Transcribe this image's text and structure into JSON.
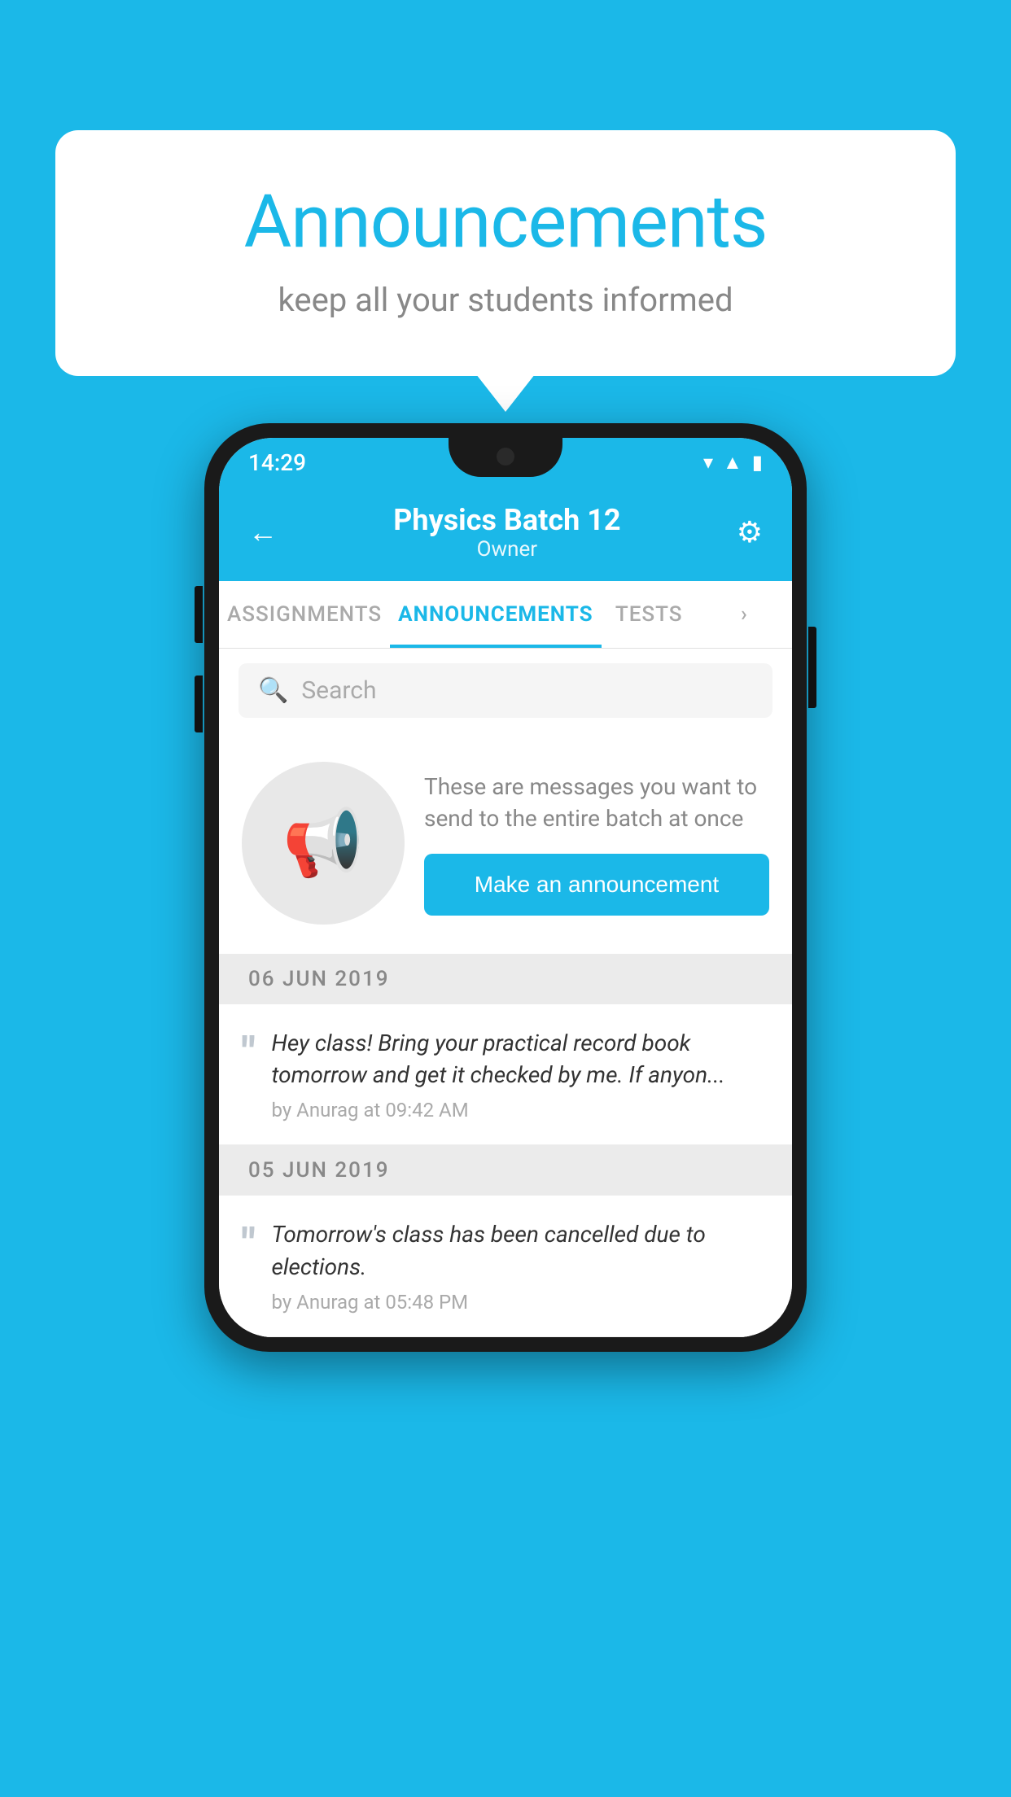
{
  "page": {
    "background_color": "#1BB8E8"
  },
  "speech_bubble": {
    "title": "Announcements",
    "subtitle": "keep all your students informed"
  },
  "phone": {
    "status_bar": {
      "time": "14:29",
      "icons": [
        "wifi",
        "signal",
        "battery"
      ]
    },
    "header": {
      "title": "Physics Batch 12",
      "subtitle": "Owner",
      "back_label": "←",
      "settings_label": "⚙"
    },
    "tabs": [
      {
        "label": "ASSIGNMENTS",
        "active": false
      },
      {
        "label": "ANNOUNCEMENTS",
        "active": true
      },
      {
        "label": "TESTS",
        "active": false
      },
      {
        "label": "›",
        "active": false
      }
    ],
    "search": {
      "placeholder": "Search"
    },
    "announcement_prompt": {
      "description": "These are messages you want to send to the entire batch at once",
      "button_label": "Make an announcement"
    },
    "announcement_list": [
      {
        "date": "06  JUN  2019",
        "items": [
          {
            "message": "Hey class! Bring your practical record book tomorrow and get it checked by me. If anyon...",
            "author": "by Anurag at 09:42 AM"
          }
        ]
      },
      {
        "date": "05  JUN  2019",
        "items": [
          {
            "message": "Tomorrow's class has been cancelled due to elections.",
            "author": "by Anurag at 05:48 PM"
          }
        ]
      }
    ]
  }
}
